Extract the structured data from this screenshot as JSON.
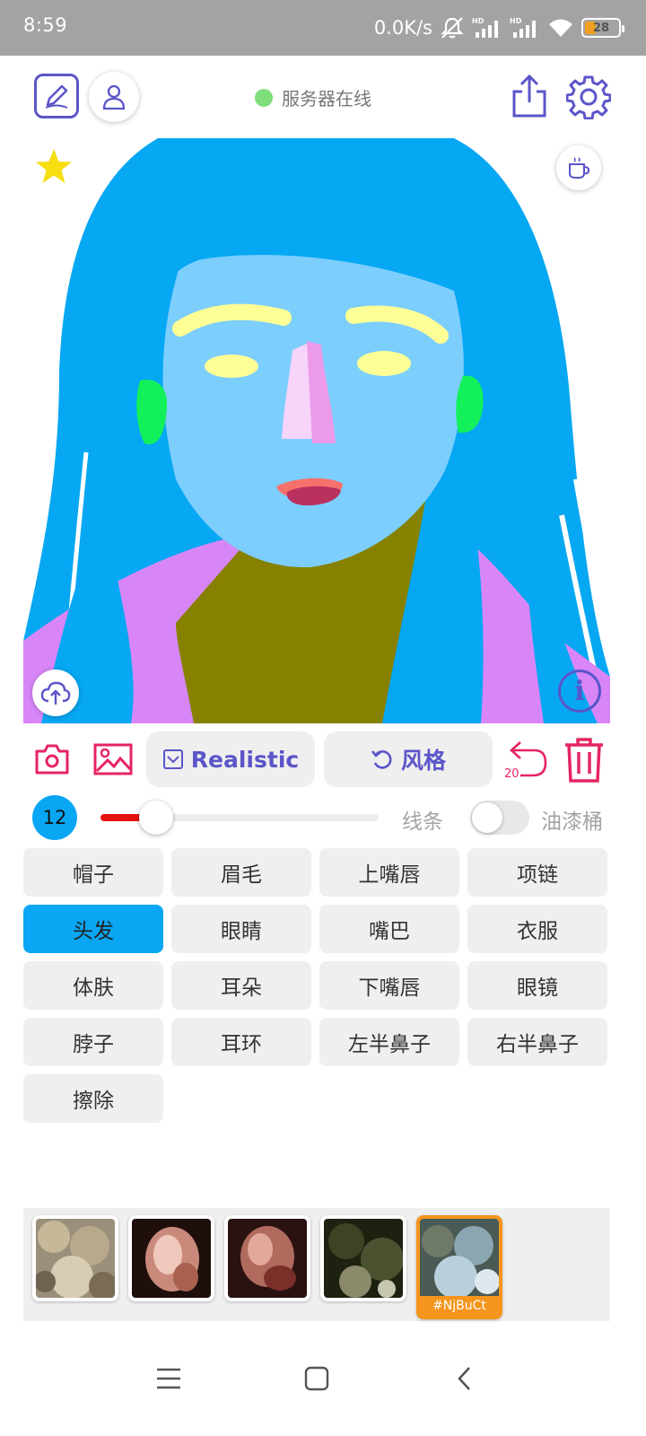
{
  "status_bar": {
    "time": "8:59",
    "network_speed": "0.0K/s",
    "battery_level": "28"
  },
  "header": {
    "server_status": "服务器在线",
    "server_status_color": "#7fdd7a"
  },
  "colors": {
    "accent": "#5b55c9",
    "danger": "#e52561",
    "active_part": "#09a6f3",
    "selected_thumb": "#f5951c"
  },
  "actions": {
    "realistic_label": "Realistic",
    "style_label": "风格",
    "undo_count": "20"
  },
  "brush": {
    "size": "12",
    "size_fraction": 0.2,
    "line_label": "线条",
    "bucket_label": "油漆桶",
    "bucket_enabled": false
  },
  "parts": [
    {
      "label": "帽子",
      "active": false
    },
    {
      "label": "眉毛",
      "active": false
    },
    {
      "label": "上嘴唇",
      "active": false
    },
    {
      "label": "项链",
      "active": false
    },
    {
      "label": "头发",
      "active": true
    },
    {
      "label": "眼睛",
      "active": false
    },
    {
      "label": "嘴巴",
      "active": false
    },
    {
      "label": "衣服",
      "active": false
    },
    {
      "label": "体肤",
      "active": false
    },
    {
      "label": "耳朵",
      "active": false
    },
    {
      "label": "下嘴唇",
      "active": false
    },
    {
      "label": "眼镜",
      "active": false
    },
    {
      "label": "脖子",
      "active": false
    },
    {
      "label": "耳环",
      "active": false
    },
    {
      "label": "左半鼻子",
      "active": false
    },
    {
      "label": "右半鼻子",
      "active": false
    },
    {
      "label": "擦除",
      "active": false
    }
  ],
  "history": {
    "selected_label": "#NjBuCt"
  }
}
